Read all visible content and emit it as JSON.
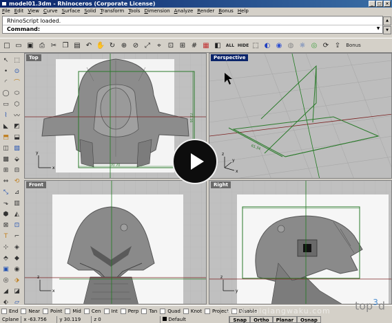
{
  "window": {
    "title": "model01.3dm - Rhinoceros (Corporate License)",
    "min_label": "_",
    "max_label": "□",
    "close_label": "×"
  },
  "menu": [
    {
      "underline": "F",
      "rest": "ile"
    },
    {
      "underline": "E",
      "rest": "dit"
    },
    {
      "underline": "V",
      "rest": "iew"
    },
    {
      "underline": "C",
      "rest": "urve"
    },
    {
      "underline": "S",
      "rest": "urface"
    },
    {
      "underline": "S",
      "rest": "olid"
    },
    {
      "underline": "T",
      "rest": "ransform"
    },
    {
      "underline": "T",
      "rest": "ools"
    },
    {
      "underline": "D",
      "rest": "imension"
    },
    {
      "underline": "A",
      "rest": "nalyze"
    },
    {
      "underline": "R",
      "rest": "ender"
    },
    {
      "underline": "B",
      "rest": "onus"
    },
    {
      "underline": "H",
      "rest": "elp"
    }
  ],
  "command": {
    "history": "RhinoScript loaded.",
    "prompt": "Command:"
  },
  "toolbar_text": {
    "all": "ALL",
    "hide": "HIDE",
    "bonus": "Bonus"
  },
  "toolbar_icons": [
    "new-file-icon",
    "open-file-icon",
    "save-icon",
    "print-icon",
    "cut-icon",
    "copy-icon",
    "paste-icon",
    "undo-icon",
    "pan-hand-icon",
    "rotate-view-icon",
    "zoom-window-icon",
    "zoom-dynamic-icon",
    "zoom-extents-icon",
    "zoom-selected-icon",
    "zoom-all-icon",
    "four-viewports-icon",
    "grid-icon",
    "layer-icon",
    "properties-icon",
    "select-icon",
    "shade-icon",
    "render-icon",
    "material-icon",
    "light-icon",
    "environment-icon",
    "turntable-icon",
    "export-icon"
  ],
  "toolbar_glyphs": [
    "□",
    "▭",
    "▣",
    "⎙",
    "✂",
    "❐",
    "▤",
    "↶",
    "✋",
    "↻",
    "⊕",
    "⊘",
    "⤢",
    "⌖",
    "⊡",
    "⊞",
    "#",
    "▦",
    "◧",
    "⬚",
    "◐",
    "◉",
    "◍",
    "☼",
    "◎",
    "⟳",
    "⇪"
  ],
  "left_tools_glyphs": [
    "↖",
    "⬚",
    "•",
    "⊙",
    "◜",
    "⌒",
    "◯",
    "⬭",
    "▭",
    "⬡",
    "⌇",
    "〰",
    "◣",
    "◩",
    "⬒",
    "⬓",
    "◫",
    "▧",
    "▩",
    "⬙",
    "⊞",
    "⊟",
    "⇔",
    "⟲",
    "⤡",
    "⊿",
    "⬎",
    "▥",
    "⬢",
    "◭",
    "⊠",
    "⊡",
    "T",
    "⌐",
    "⊹",
    "◈",
    "⬘",
    "◆",
    "▣",
    "◉",
    "◎",
    "⬗",
    "◢",
    "◪",
    "⬖",
    "▱"
  ],
  "viewports": {
    "top": {
      "label": "Top",
      "dimension_h": "70.70",
      "dimension_v": "73.16"
    },
    "perspective": {
      "label": "Perspective",
      "dimension": "65.34"
    },
    "front": {
      "label": "Front"
    },
    "right": {
      "label": "Right"
    }
  },
  "axis": {
    "x": "x",
    "y": "y",
    "z": "z"
  },
  "osnap": [
    "End",
    "Near",
    "Point",
    "Mid",
    "Cen",
    "Int",
    "Perp",
    "Tan",
    "Quad",
    "Knot",
    "Project",
    "Disable"
  ],
  "status": {
    "cplane": "Cplane",
    "x": "x -63.756",
    "y": "y 30.119",
    "z": "z 0",
    "layer": "Default",
    "snap": "Snap",
    "ortho": "Ortho",
    "planar": "Planar",
    "osnap": "Osnap"
  },
  "watermark": {
    "brand": "top",
    "sup": "3",
    "brand_end": "d",
    "site": "www.zuiqiangwaku.com"
  },
  "colors": {
    "active_viewport": "#0a246a",
    "curve_green": "#2a7a2a",
    "titlebar": "#0a246a"
  }
}
